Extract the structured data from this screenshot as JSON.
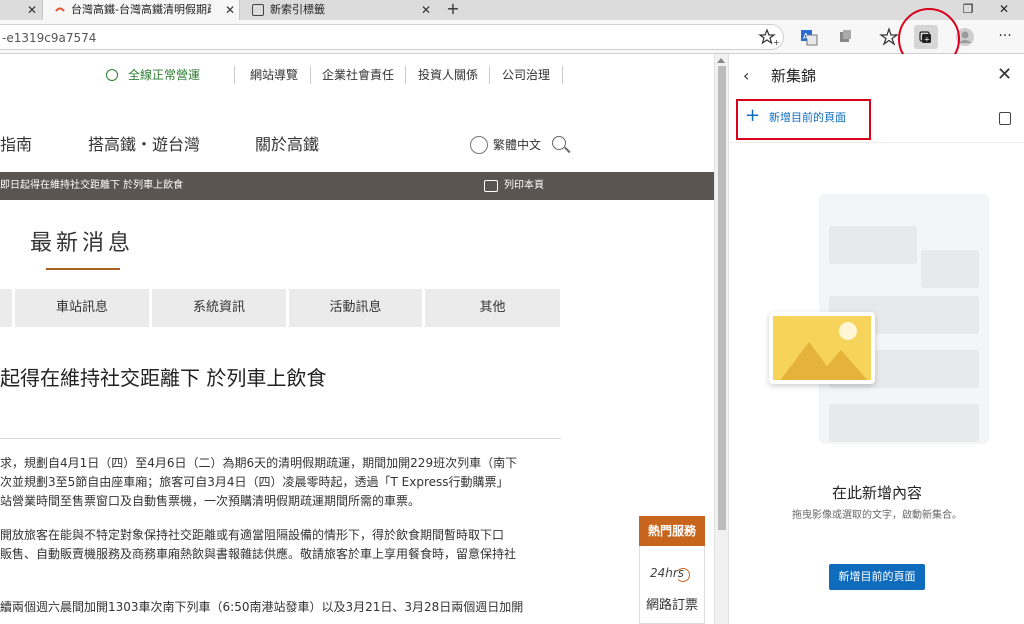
{
  "browser": {
    "tabs": [
      {
        "label": "台灣高鐵-台灣高鐵清明假期疏運"
      },
      {
        "label": "新索引標籤"
      }
    ],
    "url": "-e1319c9a7574"
  },
  "site": {
    "utility": {
      "status": "全線正常營運",
      "links": [
        "網站導覽",
        "企業社會責任",
        "投資人關係",
        "公司治理"
      ]
    },
    "mainnav": [
      "指南",
      "搭高鐵・遊台灣",
      "關於高鐵"
    ],
    "language": "繁體中文",
    "notice": "即日起得在維持社交距離下 於列車上飲食",
    "print_label": "列印本頁",
    "news_title": "最新消息",
    "category_tabs": [
      "車站訊息",
      "系統資訊",
      "活動訊息",
      "其他"
    ],
    "headline": "起得在維持社交距離下 於列車上飲食",
    "paragraphs": [
      "求，規劃自4月1日（四）至4月6日（二）為期6天的清明假期疏運，期間加開229班次列車（南下",
      "次並規劃3至5節自由座車廂；旅客可自3月4日（四）凌晨零時起，透過「T Express行動購票」",
      "站營業時間至售票窗口及自動售票機，一次預購清明假期疏運期間所需的車票。",
      "開放旅客在能與不特定對象保持社交距離或有適當阻隔設備的情形下，得於飲食期間暫時取下口",
      "販售、自動販賣機服務及商務車廂熱飲與書報雜誌供應。敬請旅客於車上享用餐食時，留意保持社",
      "續兩個週六晨間加開1303車次南下列車（6:50南港站發車）以及3月21日、3月28日兩個週日加開"
    ],
    "hot_service": {
      "title": "熱門服務",
      "badge": "24hrs",
      "label": "網路訂票"
    }
  },
  "collections": {
    "title": "新集錦",
    "add_current": "新增目前的頁面",
    "empty_heading": "在此新增內容",
    "empty_desc": "拖曳影像或選取的文字，啟動新集合。",
    "button": "新增目前的頁面"
  },
  "colors": {
    "accent": "#0f6cbd",
    "highlight": "#d9001b",
    "brand_orange": "#c8651d",
    "notice_bg": "#5b5552"
  }
}
